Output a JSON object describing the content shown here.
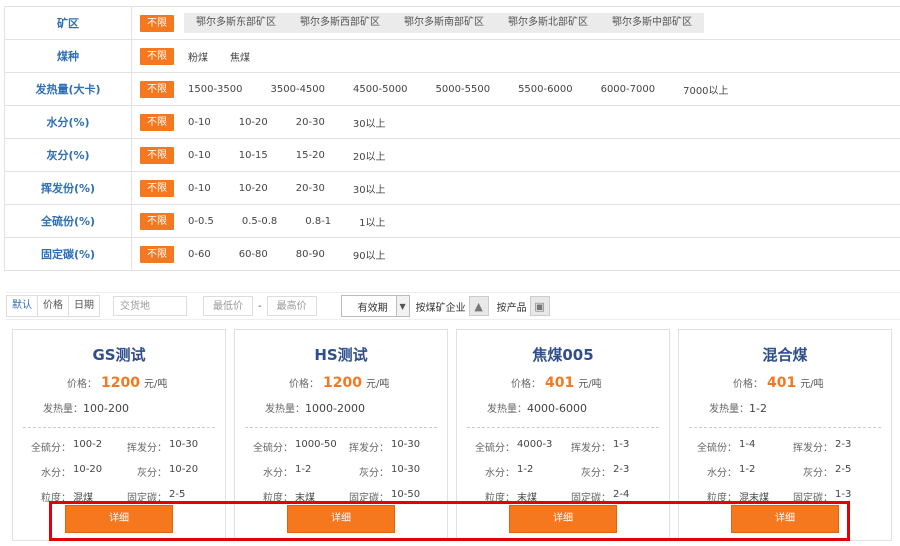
{
  "filters": [
    {
      "label": "矿区",
      "unlimited": "不限",
      "options": [
        "鄂尔多斯东部矿区",
        "鄂尔多斯西部矿区",
        "鄂尔多斯南部矿区",
        "鄂尔多斯北部矿区",
        "鄂尔多斯中部矿区"
      ]
    },
    {
      "label": "煤种",
      "unlimited": "不限",
      "options": [
        "粉煤",
        "焦煤"
      ]
    },
    {
      "label": "发热量(大卡)",
      "unlimited": "不限",
      "options": [
        "1500-3500",
        "3500-4500",
        "4500-5000",
        "5000-5500",
        "5500-6000",
        "6000-7000",
        "7000以上"
      ]
    },
    {
      "label": "水分(%)",
      "unlimited": "不限",
      "options": [
        "0-10",
        "10-20",
        "20-30",
        "30以上"
      ]
    },
    {
      "label": "灰分(%)",
      "unlimited": "不限",
      "options": [
        "0-10",
        "10-15",
        "15-20",
        "20以上"
      ]
    },
    {
      "label": "挥发份(%)",
      "unlimited": "不限",
      "options": [
        "0-10",
        "10-20",
        "20-30",
        "30以上"
      ]
    },
    {
      "label": "全硫份(%)",
      "unlimited": "不限",
      "options": [
        "0-0.5",
        "0.5-0.8",
        "0.8-1",
        "1以上"
      ]
    },
    {
      "label": "固定碳(%)",
      "unlimited": "不限",
      "options": [
        "0-60",
        "60-80",
        "80-90",
        "90以上"
      ]
    }
  ],
  "toolbar": {
    "sort_default": "默认",
    "sort_price": "价格",
    "sort_date": "日期",
    "delivery_placeholder": "交货地",
    "min_price_placeholder": "最低价",
    "dash": "-",
    "max_price_placeholder": "最高价",
    "validity": "有效期",
    "by_company": "按煤矿企业",
    "by_product": "按产品"
  },
  "cards": [
    {
      "title": "GS测试",
      "price_label": "价格：",
      "price": "1200",
      "unit": "元/吨",
      "heat_label": "发热量：",
      "heat": "100-200",
      "sulfur_label": "全硫分：",
      "sulfur": "100-2",
      "volatile_label": "挥发分：",
      "volatile": "10-30",
      "water_label": "水分：",
      "water": "10-20",
      "ash_label": "灰分：",
      "ash": "10-20",
      "size_label": "粒度：",
      "size": "混煤",
      "carbon_label": "固定碳：",
      "carbon": "2-5",
      "button": "详细"
    },
    {
      "title": "HS测试",
      "price_label": "价格：",
      "price": "1200",
      "unit": "元/吨",
      "heat_label": "发热量：",
      "heat": "1000-2000",
      "sulfur_label": "全硫分：",
      "sulfur": "1000-50",
      "volatile_label": "挥发分：",
      "volatile": "10-30",
      "water_label": "水分：",
      "water": "1-2",
      "ash_label": "灰分：",
      "ash": "10-30",
      "size_label": "粒度：",
      "size": "末煤",
      "carbon_label": "固定碳：",
      "carbon": "10-50",
      "button": "详细"
    },
    {
      "title": "焦煤005",
      "price_label": "价格：",
      "price": "401",
      "unit": "元/吨",
      "heat_label": "发热量：",
      "heat": "4000-6000",
      "sulfur_label": "全硫分：",
      "sulfur": "4000-3",
      "volatile_label": "挥发分：",
      "volatile": "1-3",
      "water_label": "水分：",
      "water": "1-2",
      "ash_label": "灰分：",
      "ash": "2-3",
      "size_label": "粒度：",
      "size": "末煤",
      "carbon_label": "固定碳：",
      "carbon": "2-4",
      "button": "详细"
    },
    {
      "title": "混合煤",
      "price_label": "价格：",
      "price": "401",
      "unit": "元/吨",
      "heat_label": "发热量：",
      "heat": "1-2",
      "sulfur_label": "全硫份：",
      "sulfur": "1-4",
      "volatile_label": "挥发分：",
      "volatile": "2-3",
      "water_label": "水分：",
      "water": "1-2",
      "ash_label": "灰分：",
      "ash": "2-5",
      "size_label": "粒度：",
      "size": "混末煤",
      "carbon_label": "固定碳：",
      "carbon": "1-3",
      "button": "详细"
    }
  ],
  "colors": {
    "accent": "#f5781e",
    "label_blue": "#2f6fb6",
    "highlight": "#e0000b"
  }
}
